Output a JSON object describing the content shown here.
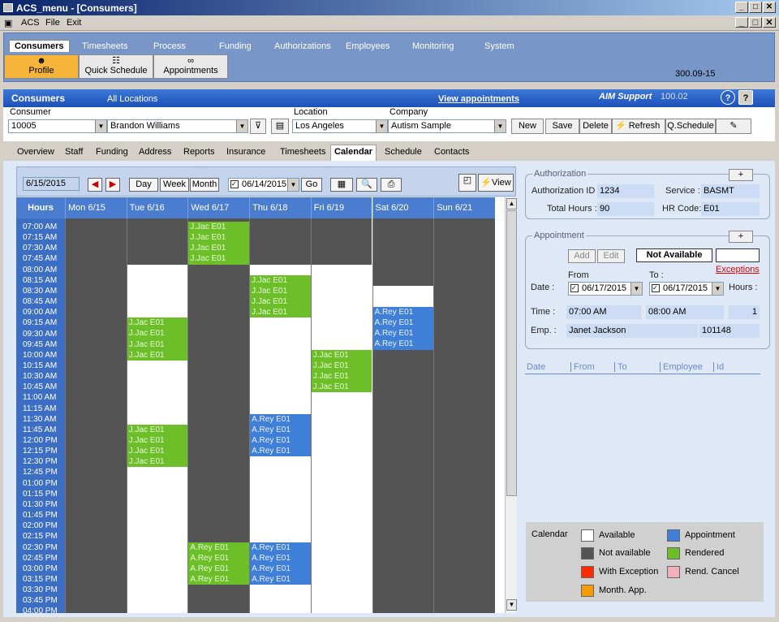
{
  "window": {
    "title": "ACS_menu - [Consumers]",
    "min": "_",
    "max": "□",
    "close": "✕"
  },
  "menu": {
    "acs": "ACS",
    "file": "File",
    "exit": "Exit"
  },
  "nav": {
    "tabs": [
      "Consumers",
      "Timesheets",
      "Process",
      "Funding",
      "Authorizations",
      "Employees",
      "Monitoring",
      "System"
    ],
    "tools": [
      "Profile",
      "Quick Schedule",
      "Appointments"
    ],
    "version": "300.09-15"
  },
  "header": {
    "title": "Consumers",
    "scope": "All Locations",
    "view_link": "View appointments",
    "support": "AIM Support",
    "support_ver": "100.02",
    "help": "?",
    "whats": "?"
  },
  "filters": {
    "consumer_label": "Consumer",
    "consumer_id": "10005",
    "consumer_name": "Brandon Williams",
    "location_label": "Location",
    "location": "Los Angeles",
    "company_label": "Company",
    "company": "Autism Sample",
    "buttons": [
      "New",
      "Save",
      "Delete",
      "Refresh",
      "Q.Schedule"
    ]
  },
  "tabs": [
    "Overview",
    "Staff",
    "Funding",
    "Address",
    "Reports",
    "Insurance",
    "Timesheets",
    "Calendar",
    "Schedule",
    "Contacts"
  ],
  "calendar": {
    "date_box": "6/15/2015",
    "buttons": {
      "day": "Day",
      "week": "Week",
      "month": "Month",
      "go": "Go",
      "view": "View"
    },
    "week_of": "06/14/2015",
    "hours_header": "Hours",
    "days": [
      "Mon 6/15",
      "Tue 6/16",
      "Wed 6/17",
      "Thu 6/18",
      "Fri 6/19",
      "Sat 6/20",
      "Sun 6/21"
    ],
    "times": [
      "07:00 AM",
      "07:15 AM",
      "07:30 AM",
      "07:45 AM",
      "08:00 AM",
      "08:15 AM",
      "08:30 AM",
      "08:45 AM",
      "09:00 AM",
      "09:15 AM",
      "09:30 AM",
      "09:45 AM",
      "10:00 AM",
      "10:15 AM",
      "10:30 AM",
      "10:45 AM",
      "11:00 AM",
      "11:15 AM",
      "11:30 AM",
      "11:45 AM",
      "12:00 PM",
      "12:15 PM",
      "12:30 PM",
      "12:45 PM",
      "01:00 PM",
      "01:15 PM",
      "01:30 PM",
      "01:45 PM",
      "02:00 PM",
      "02:15 PM",
      "02:30 PM",
      "02:45 PM",
      "03:00 PM",
      "03:15 PM",
      "03:30 PM",
      "03:45 PM",
      "04:00 PM"
    ],
    "available": [
      {
        "day": 1,
        "start": 4,
        "end": 37
      },
      {
        "day": 3,
        "start": 4,
        "end": 37
      },
      {
        "day": 4,
        "start": 4,
        "end": 37
      },
      {
        "day": 5,
        "start": 6,
        "end": 8
      }
    ],
    "appointments": [
      {
        "day": 2,
        "start": 0,
        "end": 4,
        "type": "rendered",
        "label": "J.Jac E01"
      },
      {
        "day": 3,
        "start": 5,
        "end": 9,
        "type": "rendered",
        "label": "J.Jac E01"
      },
      {
        "day": 1,
        "start": 9,
        "end": 13,
        "type": "rendered",
        "label": "J.Jac E01"
      },
      {
        "day": 5,
        "start": 8,
        "end": 12,
        "type": "appointment",
        "label": "A.Rey E01"
      },
      {
        "day": 4,
        "start": 12,
        "end": 16,
        "type": "rendered",
        "label": "J.Jac E01"
      },
      {
        "day": 3,
        "start": 18,
        "end": 22,
        "type": "appointment",
        "label": "A.Rey E01"
      },
      {
        "day": 1,
        "start": 19,
        "end": 23,
        "type": "rendered",
        "label": "J.Jac E01"
      },
      {
        "day": 2,
        "start": 30,
        "end": 34,
        "type": "rendered",
        "label": "A.Rey E01"
      },
      {
        "day": 3,
        "start": 30,
        "end": 34,
        "type": "appointment",
        "label": "A.Rey E01"
      }
    ]
  },
  "authorization": {
    "title": "Authorization",
    "plus": "+",
    "id_label": "Authorization ID :",
    "id": "1234",
    "service_label": "Service :",
    "service": "BASMT",
    "hours_label": "Total Hours :",
    "hours": "90",
    "hr_label": "HR Code:",
    "hr": "E01"
  },
  "appointment": {
    "title": "Appointment",
    "plus": "+",
    "add": "Add",
    "edit": "Edit",
    "status": "Not Available",
    "exceptions": "Exceptions",
    "from_label": "From",
    "to_label": "To :",
    "date_label": "Date :",
    "from_date": "06/17/2015",
    "to_date": "06/17/2015",
    "hours_label": "Hours :",
    "time_label": "Time :",
    "start": "07:00 AM",
    "end": "08:00 AM",
    "hours": "1",
    "emp_label": "Emp. :",
    "emp": "Janet Jackson",
    "emp_id": "101148"
  },
  "list_headers": [
    "Date",
    "From",
    "To",
    "Employee",
    "Id"
  ],
  "legend": {
    "title": "Calendar",
    "items": [
      {
        "label": "Available",
        "color": "#ffffff"
      },
      {
        "label": "Appointment",
        "color": "#3f7fd8"
      },
      {
        "label": "Not available",
        "color": "#545454"
      },
      {
        "label": "Rendered",
        "color": "#6dbf2a"
      },
      {
        "label": "With Exception",
        "color": "#ff2a00"
      },
      {
        "label": "Rend. Cancel",
        "color": "#f4b0b8"
      },
      {
        "label": "Month. App.",
        "color": "#f49c00"
      }
    ]
  }
}
